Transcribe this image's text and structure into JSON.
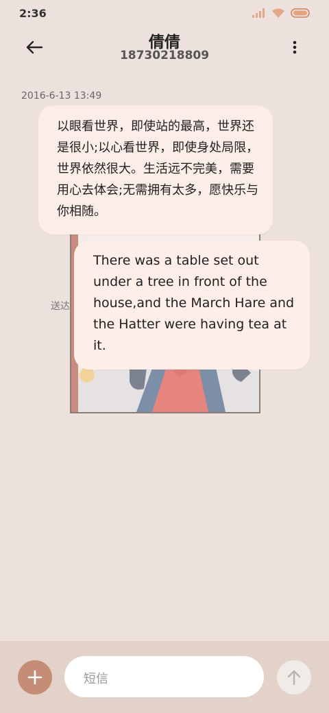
{
  "status_bar": {
    "time": "2:36",
    "icons": [
      "signal-icon",
      "wifi-icon",
      "battery-icon"
    ],
    "accent": "#e9a27e"
  },
  "header": {
    "back_icon": "arrow-left-icon",
    "contact_name": "倩倩",
    "contact_number": "18730218809",
    "more_icon": "more-vertical-icon"
  },
  "conversation": {
    "timestamp": "2016-6-13 13:49",
    "sent_status": "送达",
    "messages": [
      {
        "text": "以眼看世界，即使站的最高，世界还是很小;以心看世界，即使身处局限，世界依然很大。生活远不完美，需要用心去体会;无需拥有太多，愿快乐与你相随。"
      },
      {
        "text": "There was a table set out under a tree in front of the house,and the March Hare and the Hatter were having tea at it."
      }
    ]
  },
  "composer": {
    "add_icon": "plus-icon",
    "placeholder": "短信",
    "send_icon": "arrow-up-icon",
    "colors": {
      "add_button": "#c58d75",
      "bar": "#e3d2ca"
    }
  }
}
